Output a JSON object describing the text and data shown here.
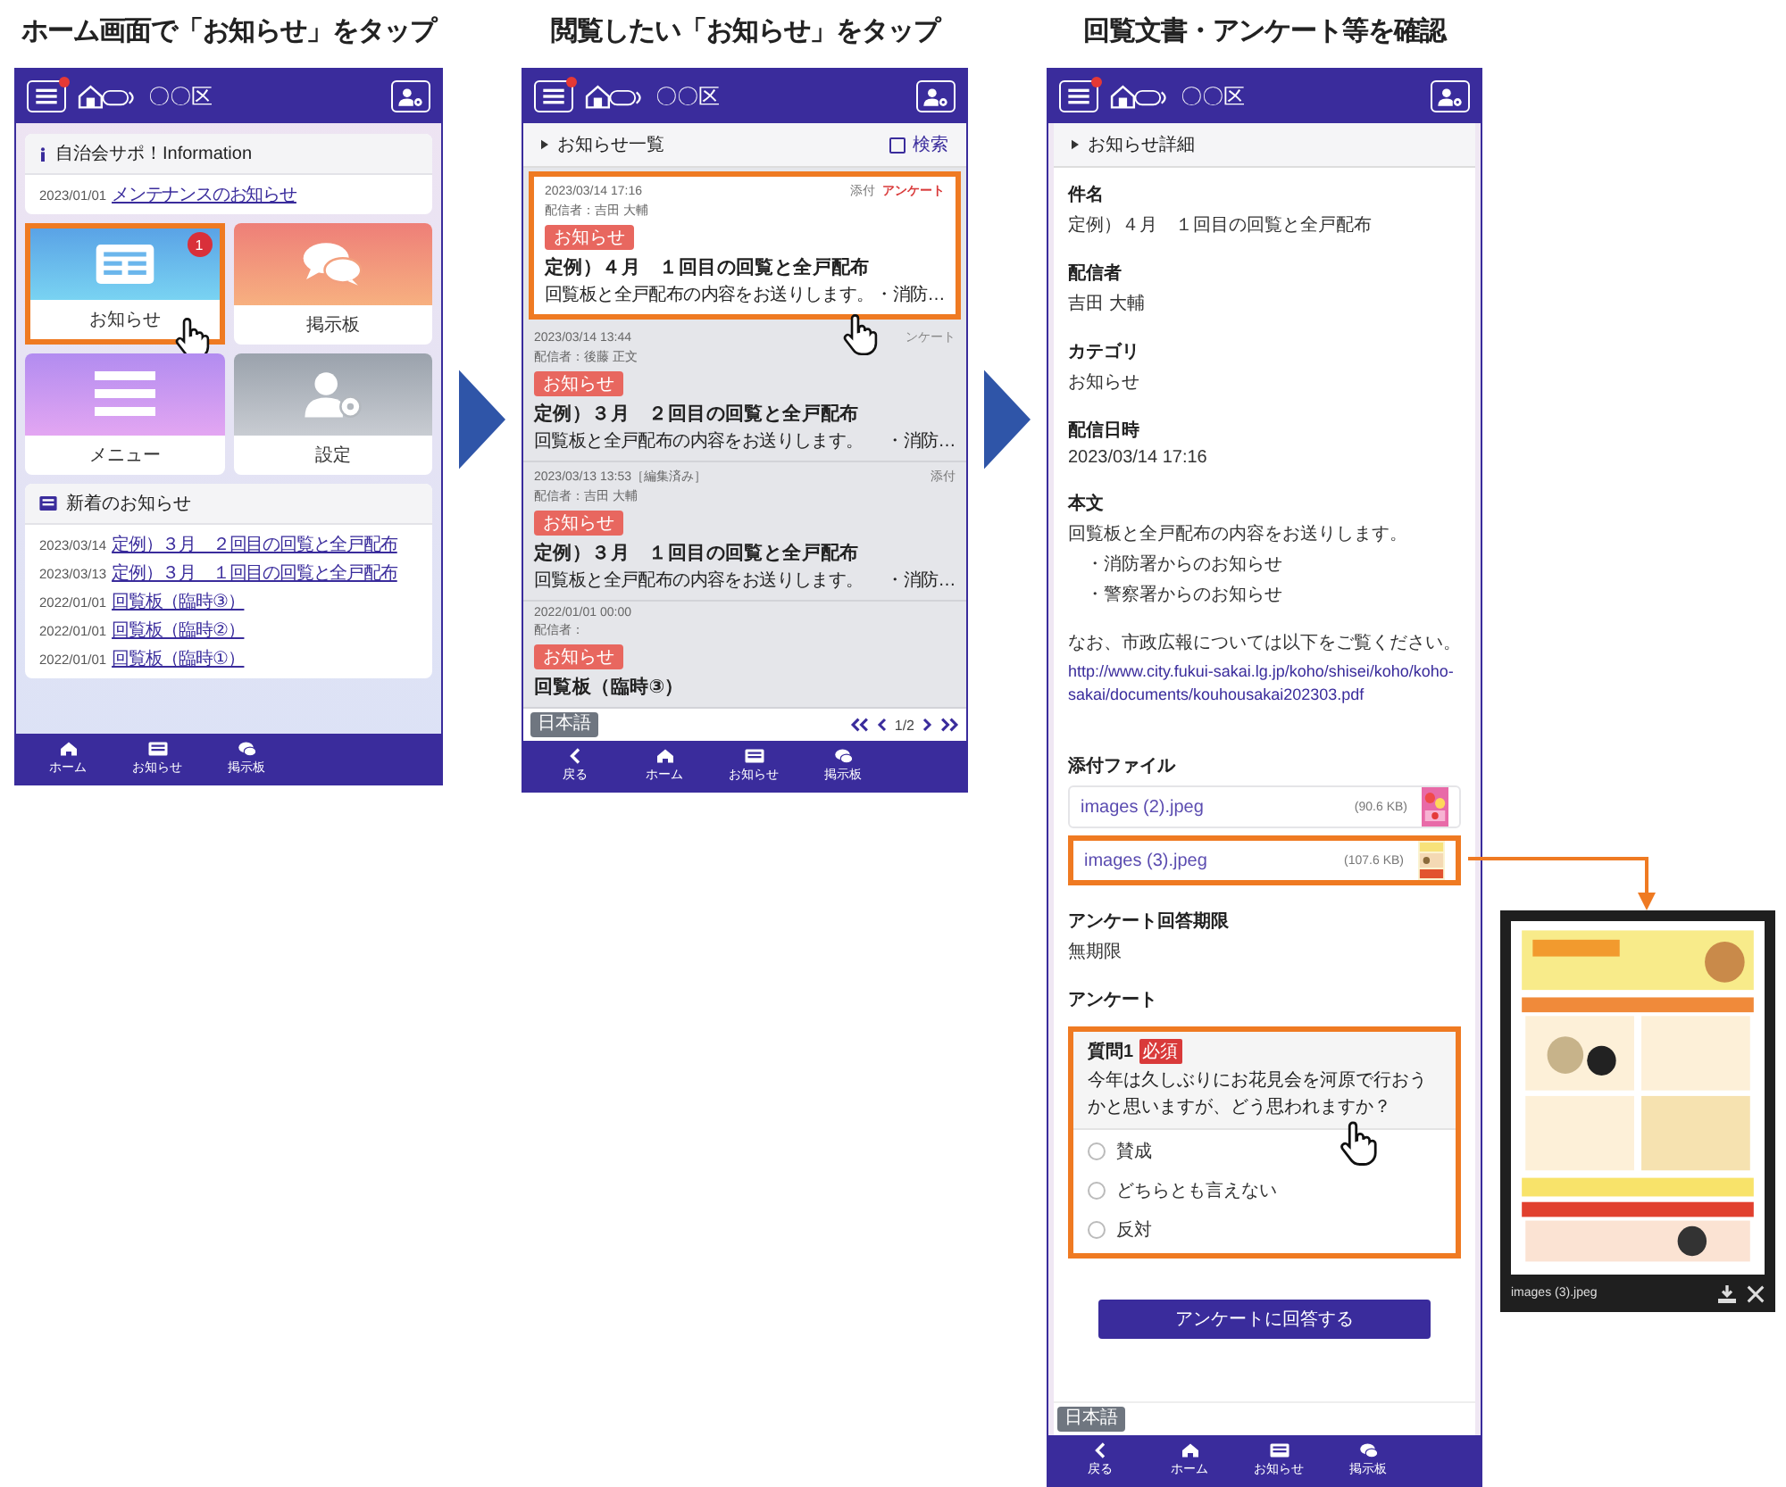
{
  "home_screen": {
    "heading": "ホーム画面で「お知らせ」をタップ",
    "header": {
      "title": "〇〇区"
    },
    "info_card": {
      "title": "自治会サポ！Information",
      "items": [
        {
          "date": "2023/01/01",
          "link": "メンテナンスのお知らせ"
        }
      ]
    },
    "tiles": [
      {
        "kind": "news",
        "label": "お知らせ",
        "badge": "1",
        "highlighted": true
      },
      {
        "kind": "board",
        "label": "掲示板",
        "highlighted": false
      },
      {
        "kind": "menu",
        "label": "メニュー",
        "highlighted": false
      },
      {
        "kind": "settings",
        "label": "設定",
        "highlighted": false
      }
    ],
    "news_card": {
      "title": "新着のお知らせ",
      "items": [
        {
          "date": "2023/03/14",
          "link": "定例）３月　２回目の回覧と全戸配布"
        },
        {
          "date": "2023/03/13",
          "link": "定例）３月　１回目の回覧と全戸配布"
        },
        {
          "date": "2022/01/01",
          "link": "回覧板（臨時③）"
        },
        {
          "date": "2022/01/01",
          "link": "回覧板（臨時②）"
        },
        {
          "date": "2022/01/01",
          "link": "回覧板（臨時①）"
        }
      ]
    },
    "bottom_nav": [
      {
        "kind": "home",
        "label": "ホーム"
      },
      {
        "kind": "news",
        "label": "お知らせ"
      },
      {
        "kind": "board",
        "label": "掲示板"
      }
    ]
  },
  "list_screen": {
    "heading": "閲覧したい「お知らせ」をタップ",
    "header": {
      "title": "〇〇区"
    },
    "panel_title": "お知らせ一覧",
    "search": {
      "label": "検索",
      "checked": false
    },
    "notices": [
      {
        "datetime": "2023/03/14 17:16",
        "sender": "配信者：吉田 大輔",
        "tag": "お知らせ",
        "title": "定例）４月　１回目の回覧と全戸配布",
        "excerpt": "回覧板と全戸配布の内容をお送りします。",
        "excerpt_more": "・消防…",
        "attachment": "添付",
        "survey": "アンケート",
        "survey_new": true,
        "highlighted": true
      },
      {
        "datetime": "2023/03/14 13:44",
        "sender": "配信者：後藤 正文",
        "tag": "お知らせ",
        "title": "定例）３月　２回目の回覧と全戸配布",
        "excerpt": "回覧板と全戸配布の内容をお送りします。",
        "excerpt_more": "・消防…",
        "survey": "ンケート",
        "survey_new": false,
        "highlighted": false
      },
      {
        "datetime": "2023/03/13 13:53",
        "edited": "［編集済み］",
        "sender": "配信者：吉田 大輔",
        "tag": "お知らせ",
        "title": "定例）３月　１回目の回覧と全戸配布",
        "excerpt": "回覧板と全戸配布の内容をお送りします。",
        "excerpt_more": "・消防…",
        "attachment": "添付",
        "highlighted": false
      },
      {
        "datetime": "2022/01/01 00:00",
        "sender": "配信者：",
        "tag": "お知らせ",
        "title": "回覧板（臨時③）",
        "highlighted": false
      }
    ],
    "language": "日本語",
    "pager": "1/2",
    "bottom_nav": [
      {
        "kind": "back",
        "label": "戻る"
      },
      {
        "kind": "home",
        "label": "ホーム"
      },
      {
        "kind": "news",
        "label": "お知らせ"
      },
      {
        "kind": "board",
        "label": "掲示板"
      }
    ]
  },
  "detail_screen": {
    "heading": "回覧文書・アンケート等を確認",
    "header": {
      "title": "〇〇区"
    },
    "panel_title": "お知らせ詳細",
    "fields": [
      {
        "label": "件名",
        "value": "定例）４月　１回目の回覧と全戸配布"
      },
      {
        "label": "配信者",
        "value": "吉田 大輔"
      },
      {
        "label": "カテゴリ",
        "value": "お知らせ"
      },
      {
        "label": "配信日時",
        "value": "2023/03/14 17:16"
      }
    ],
    "body": {
      "label": "本文",
      "lines": [
        "回覧板と全戸配布の内容をお送りします。",
        "・消防署からのお知らせ",
        "・警察署からのお知らせ"
      ],
      "note": "なお、市政広報については以下をご覧ください。",
      "link": "http://www.city.fukui-sakai.lg.jp/koho/shisei/koho/koho-sakai/documents/kouhousakai202303.pdf"
    },
    "attachments": {
      "label": "添付ファイル",
      "files": [
        {
          "name": "images (2).jpeg",
          "size": "(90.6 KB)",
          "highlighted": false
        },
        {
          "name": "images (3).jpeg",
          "size": "(107.6 KB)",
          "highlighted": true
        }
      ]
    },
    "deadline": {
      "label": "アンケート回答期限",
      "value": "無期限"
    },
    "survey": {
      "label": "アンケート",
      "number": "質問1",
      "required": "必須",
      "question": "今年は久しぶりにお花見会を河原で行おうかと思いますが、どう思われますか？",
      "highlighted": true,
      "options": [
        {
          "label": "賛成",
          "selected": false
        },
        {
          "label": "どちらとも言えない",
          "selected": false
        },
        {
          "label": "反対",
          "selected": false
        }
      ],
      "submit": "アンケートに回答する"
    },
    "language": "日本語",
    "bottom_nav": [
      {
        "kind": "back",
        "label": "戻る"
      },
      {
        "kind": "home",
        "label": "ホーム"
      },
      {
        "kind": "news",
        "label": "お知らせ"
      },
      {
        "kind": "board",
        "label": "掲示板"
      }
    ]
  },
  "image_viewer": {
    "caption": "images (3).jpeg"
  }
}
